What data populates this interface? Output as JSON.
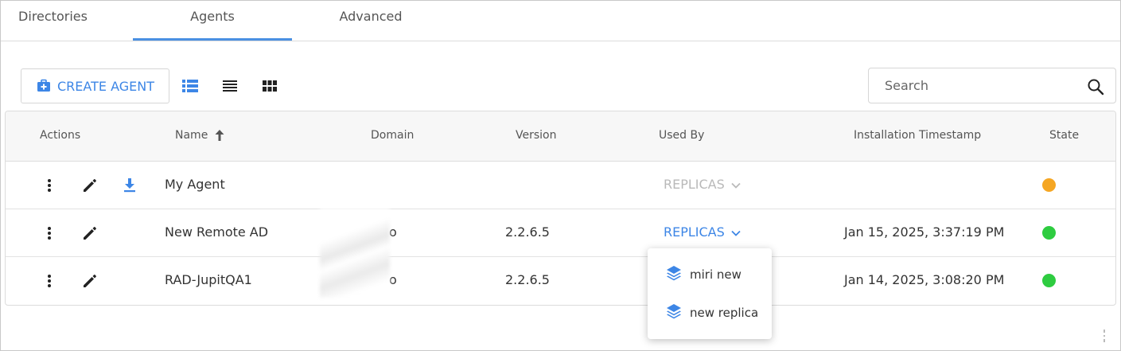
{
  "tabs": [
    {
      "label": "Directories"
    },
    {
      "label": "Agents"
    },
    {
      "label": "Advanced"
    }
  ],
  "active_tab": "Agents",
  "toolbar": {
    "create_label": "CREATE AGENT",
    "search_placeholder": "Search"
  },
  "table": {
    "headers": {
      "actions": "Actions",
      "name": "Name",
      "domain": "Domain",
      "version": "Version",
      "used_by": "Used By",
      "installation_timestamp": "Installation Timestamp",
      "state": "State"
    },
    "rows": [
      {
        "name": "My Agent",
        "domain": "",
        "version": "",
        "used_by": "REPLICAS",
        "timestamp": "",
        "state_color": "#f5a623"
      },
      {
        "name": "New Remote AD",
        "domain": "o",
        "version": "2.2.6.5",
        "used_by": "REPLICAS",
        "timestamp": "Jan 15, 2025, 3:37:19 PM",
        "state_color": "#2ecc40"
      },
      {
        "name": "RAD-JupitQA1",
        "domain": "o",
        "version": "2.2.6.5",
        "used_by": "",
        "timestamp": "Jan 14, 2025, 3:08:20 PM",
        "state_color": "#2ecc40"
      }
    ]
  },
  "dropdown": {
    "items": [
      {
        "label": "miri new"
      },
      {
        "label": "new replica"
      }
    ]
  },
  "colors": {
    "accent": "#3d86e6",
    "disabled": "#b9b9b9",
    "state_pending": "#f5a623",
    "state_ok": "#2ecc40"
  }
}
